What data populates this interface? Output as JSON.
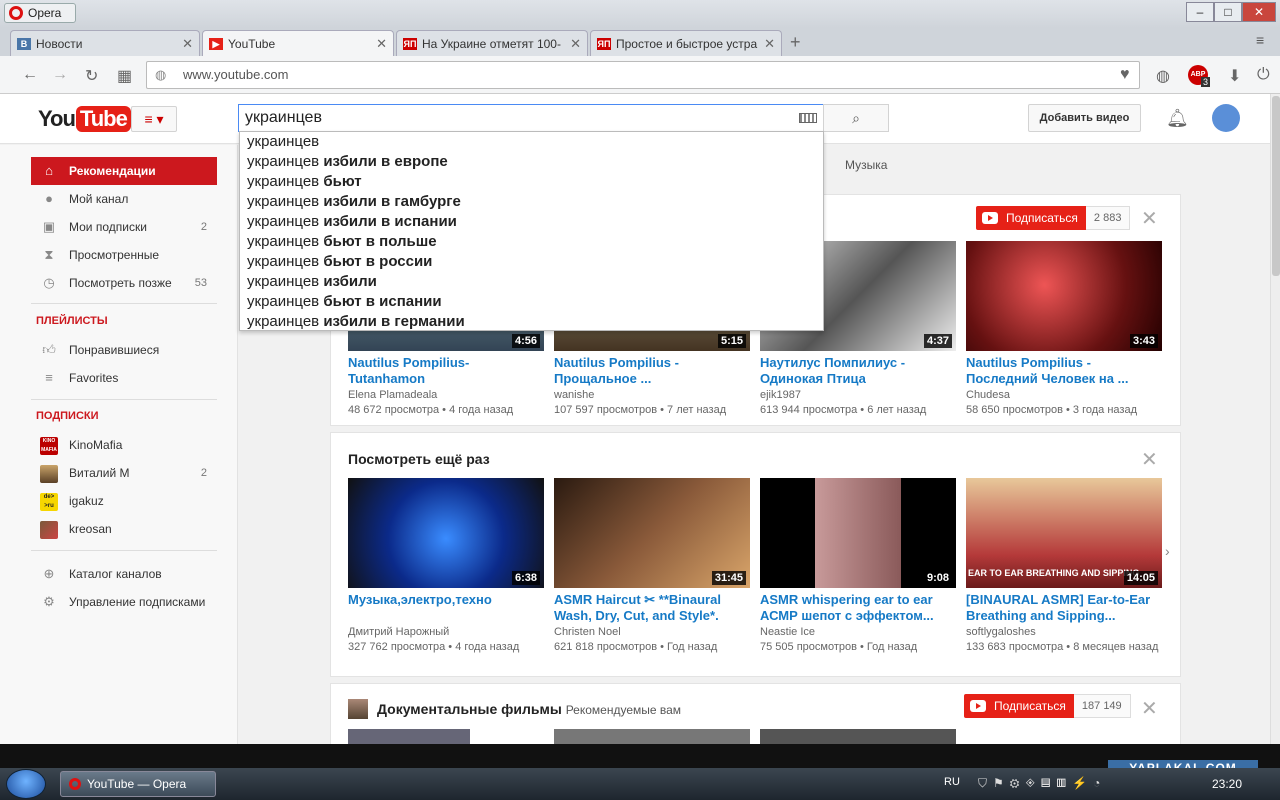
{
  "window": {
    "title": "Opera"
  },
  "tabs": [
    {
      "label": "Новости",
      "favicon": "vk-icon"
    },
    {
      "label": "YouTube",
      "favicon": "youtube-icon"
    },
    {
      "label": "На Украине отметят 100-",
      "favicon": "yaplakal-icon",
      "favicon_text": "ЯП"
    },
    {
      "label": "Простое и быстрое устра",
      "favicon": "yaplakal-icon",
      "favicon_text": "ЯП"
    }
  ],
  "address": {
    "url": "www.youtube.com",
    "abp_badge": "ABP",
    "abp_count": "3"
  },
  "yt": {
    "logo_you": "You",
    "logo_tube": "Tube",
    "logo_region": "RU",
    "search_value": "украинцев",
    "upload_label": "Добавить видео",
    "suggestions": [
      {
        "prefix": "украинцев",
        "rest": ""
      },
      {
        "prefix": "украинцев",
        "rest": "избили в европе"
      },
      {
        "prefix": "украинцев",
        "rest": "бьют"
      },
      {
        "prefix": "украинцев",
        "rest": "избили в гамбурге"
      },
      {
        "prefix": "украинцев",
        "rest": "избили в испании"
      },
      {
        "prefix": "украинцев",
        "rest": "бьют в польше"
      },
      {
        "prefix": "украинцев",
        "rest": "бьют в россии"
      },
      {
        "prefix": "украинцев",
        "rest": "избили"
      },
      {
        "prefix": "украинцев",
        "rest": "бьют в испании"
      },
      {
        "prefix": "украинцев",
        "rest": "избили в германии"
      }
    ],
    "feed_tab": "Музыка"
  },
  "sidebar": {
    "main": [
      {
        "label": "Рекомендации",
        "icon": "home-icon"
      },
      {
        "label": "Мой канал",
        "icon": "person-icon"
      },
      {
        "label": "Мои подписки",
        "icon": "subscriptions-icon",
        "count": "2"
      },
      {
        "label": "Просмотренные",
        "icon": "hourglass-icon"
      },
      {
        "label": "Посмотреть позже",
        "icon": "clock-icon",
        "count": "53"
      }
    ],
    "playlists_heading": "ПЛЕЙЛИСТЫ",
    "playlists": [
      {
        "label": "Понравившиеся",
        "icon": "thumb-up-icon"
      },
      {
        "label": "Favorites",
        "icon": "list-icon"
      }
    ],
    "subs_heading": "ПОДПИСКИ",
    "subs": [
      {
        "label": "KinoMafia",
        "icon_text": "KINO MAFIA"
      },
      {
        "label": "Виталий М",
        "count": "2"
      },
      {
        "label": "igakuz",
        "icon_text": "de> >ru"
      },
      {
        "label": "kreosan"
      }
    ],
    "bottom": [
      {
        "label": "Каталог каналов",
        "icon": "plus-circle-icon"
      },
      {
        "label": "Управление подписками",
        "icon": "gear-icon"
      }
    ]
  },
  "section1": {
    "subscribe_label": "Подписаться",
    "subscribe_count": "2 883",
    "videos": [
      {
        "title": "Nautilus Pompilius- Tutanhamon",
        "channel": "Elena Plamadeala",
        "views": "48 672 просмотра",
        "age": "4 года назад",
        "duration": "4:56"
      },
      {
        "title": "Nautilus Pompilius - Прощальное ...",
        "channel": "wanishe",
        "views": "107 597 просмотров",
        "age": "7 лет назад",
        "duration": "5:15"
      },
      {
        "title": "Наутилус Помпилиус - Одинокая Птица",
        "channel": "ejik1987",
        "views": "613 944 просмотра",
        "age": "6 лет назад",
        "duration": "4:37"
      },
      {
        "title": "Nautilus Pompilius - Последний Человек на ...",
        "channel": "Chudesa",
        "views": "58 650 просмотров",
        "age": "3 года назад",
        "duration": "3:43"
      }
    ]
  },
  "section2": {
    "title": "Посмотреть ещё раз",
    "videos": [
      {
        "title": "Музыка,электро,техно",
        "channel": "Дмитрий Нарожный",
        "views": "327 762 просмотра",
        "age": "4 года назад",
        "duration": "6:38"
      },
      {
        "title": "ASMR Haircut ✂ **Binaural Wash, Dry, Cut, and Style*.",
        "channel": "Christen Noel",
        "views": "621 818 просмотров",
        "age": "Год назад",
        "duration": "31:45"
      },
      {
        "title": "ASMR whispering ear to ear АСМР шепот с эффектом...",
        "channel": "Neastie Ice",
        "views": "75 505 просмотров",
        "age": "Год назад",
        "duration": "9:08"
      },
      {
        "title": "[BINAURAL ASMR] Ear-to-Ear Breathing and Sipping...",
        "channel": "softlygaloshes",
        "views": "133 683 просмотра",
        "age": "8 месяцев назад",
        "duration": "14:05",
        "thumb_text": "EAR TO EAR BREATHING AND SIPPING"
      }
    ]
  },
  "section3": {
    "title": "Документальные фильмы",
    "subtitle": "Рекомендуемые вам",
    "subscribe_label": "Подписаться",
    "subscribe_count": "187 149"
  },
  "taskbar": {
    "app_label": "YouTube — Opera",
    "lang": "RU",
    "time": "23:20",
    "watermark": "YAPLAKAL.COM"
  },
  "colors": {
    "yt_red": "#e62117",
    "link_blue": "#167ac6",
    "active_red": "#cc181e"
  }
}
